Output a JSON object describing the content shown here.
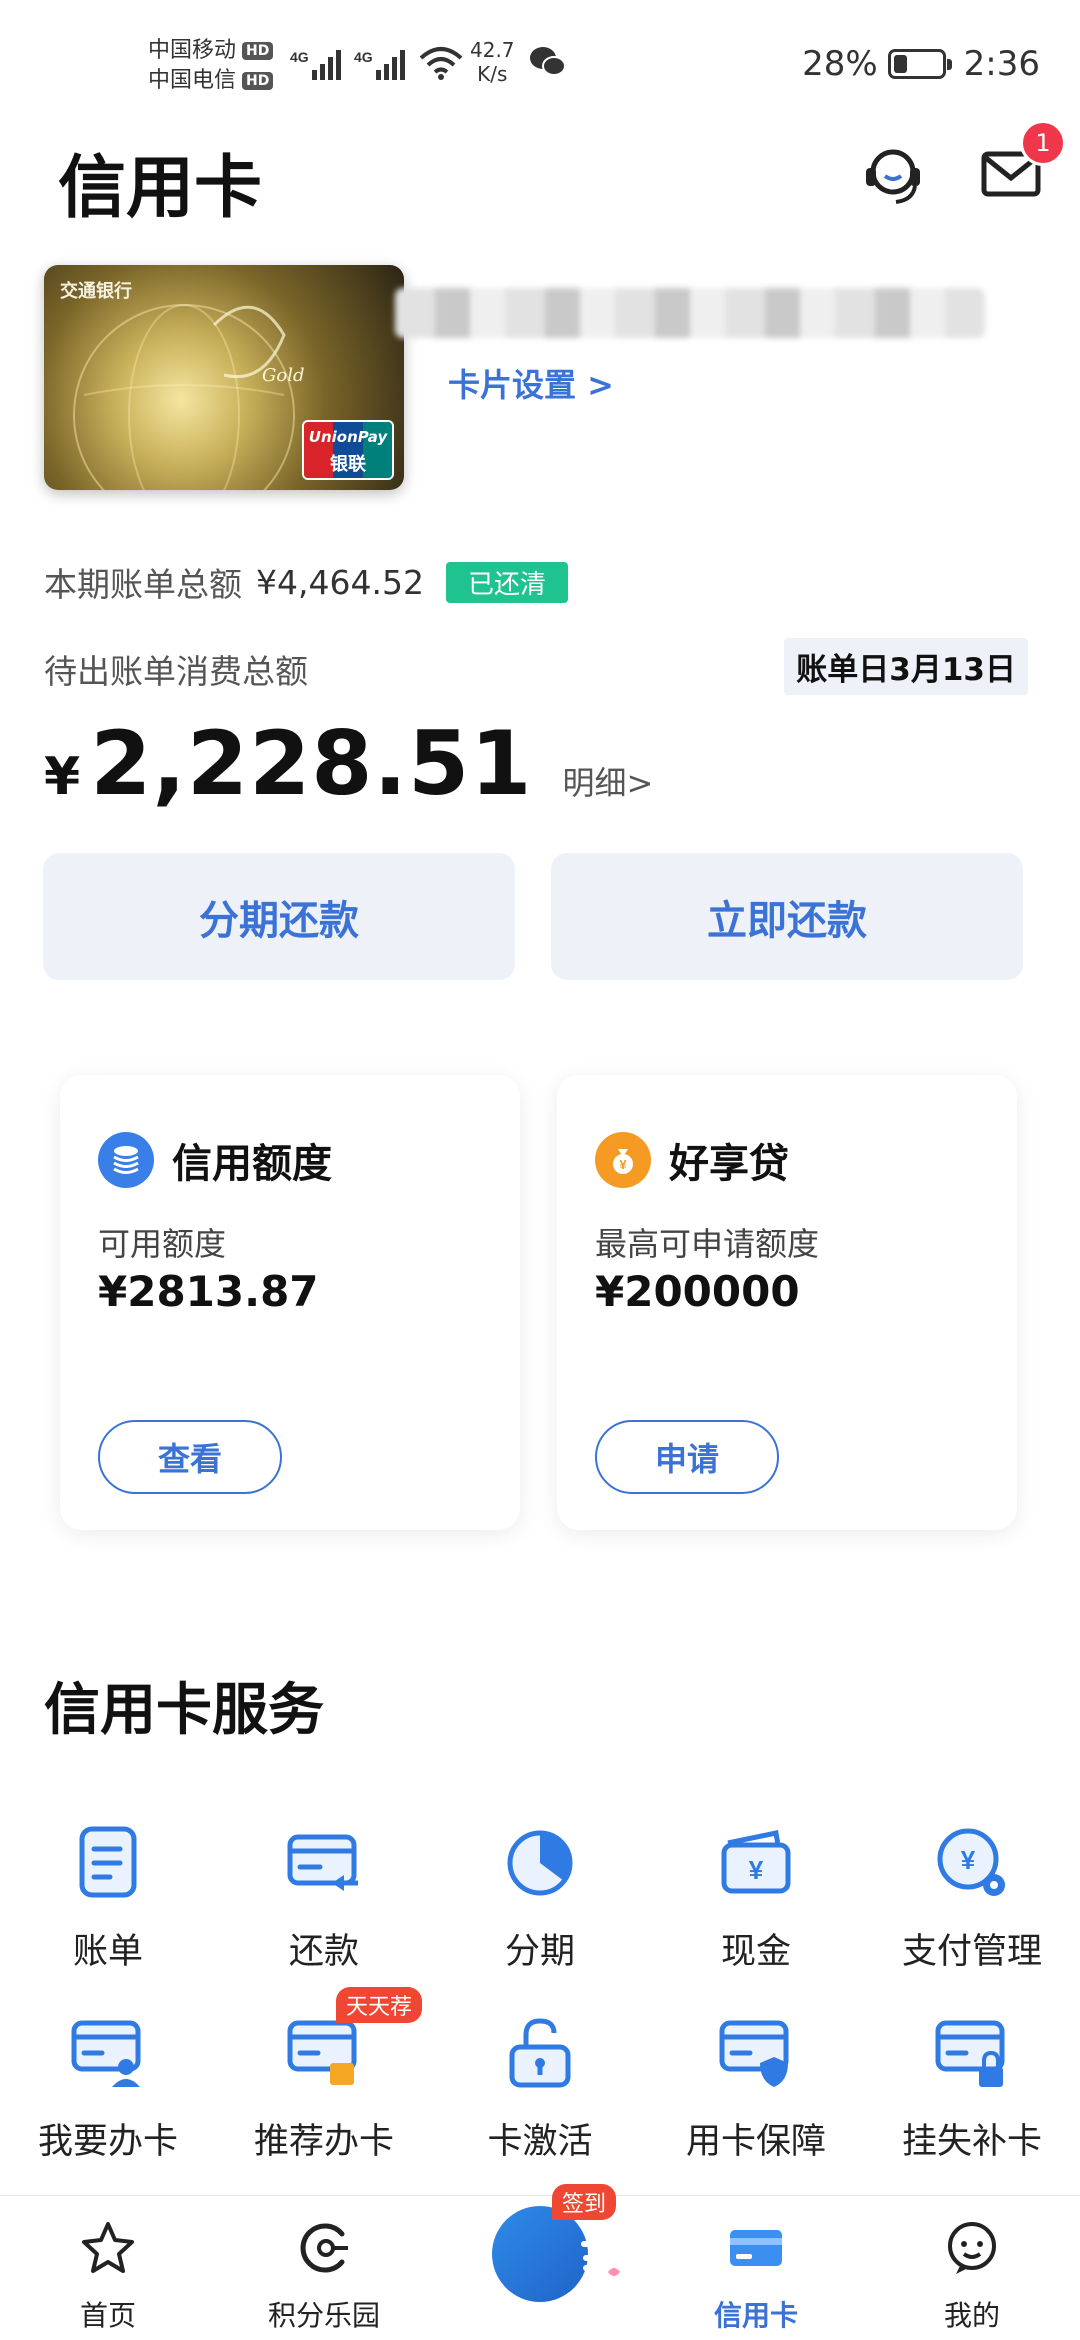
{
  "status_bar": {
    "carrier1": "中国移动",
    "carrier2": "中国电信",
    "hd": "HD",
    "net1": "4G",
    "net2": "4G",
    "speed_value": "42.7",
    "speed_unit": "K/s",
    "battery": "28%",
    "battery_level": 0.28,
    "time": "2:36"
  },
  "header": {
    "title": "信用卡",
    "mail_badge": "1",
    "icons": [
      "customer-service-icon",
      "mail-icon"
    ]
  },
  "card": {
    "bank_name": "交通银行",
    "tier": "Gold",
    "network_en": "UnionPay",
    "network_cn": "银联",
    "settings_label": "卡片设置 >"
  },
  "bill": {
    "total_label": "本期账单总额",
    "total_amount": "¥4,464.52",
    "status_badge": "已还清",
    "pending_label": "待出账单消费总额",
    "bill_day": "账单日3月13日",
    "currency": "¥",
    "pending_amount": "2,228.51",
    "detail_link": "明细>"
  },
  "actions": {
    "installment": "分期还款",
    "repay_now": "立即还款"
  },
  "credit_card": {
    "title": "信用额度",
    "sub": "可用额度",
    "value": "¥2813.87",
    "button": "查看"
  },
  "loan_card": {
    "title": "好享贷",
    "sub": "最高可申请额度",
    "value": "¥200000",
    "button": "申请"
  },
  "services": {
    "title": "信用卡服务",
    "items": [
      {
        "label": "账单",
        "icon": "bill-icon"
      },
      {
        "label": "还款",
        "icon": "repay-icon"
      },
      {
        "label": "分期",
        "icon": "installment-icon"
      },
      {
        "label": "现金",
        "icon": "cash-icon"
      },
      {
        "label": "支付管理",
        "icon": "payment-settings-icon"
      },
      {
        "label": "我要办卡",
        "icon": "apply-card-icon"
      },
      {
        "label": "推荐办卡",
        "icon": "recommend-card-icon",
        "tag": "天天荐"
      },
      {
        "label": "卡激活",
        "icon": "unlock-icon"
      },
      {
        "label": "用卡保障",
        "icon": "card-shield-icon"
      },
      {
        "label": "挂失补卡",
        "icon": "card-lock-icon"
      }
    ]
  },
  "bottom_nav": {
    "items": [
      {
        "label": "首页",
        "icon": "star-icon"
      },
      {
        "label": "积分乐园",
        "icon": "points-icon"
      },
      {
        "label": "",
        "icon": "sign-in-icon",
        "tag": "签到"
      },
      {
        "label": "信用卡",
        "icon": "credit-card-icon",
        "active": true
      },
      {
        "label": "我的",
        "icon": "profile-icon"
      }
    ]
  },
  "colors": {
    "accent": "#3a72d6",
    "paid_green": "#1ec38f",
    "badge_red": "#f0364a",
    "button_bg": "#eef1f7"
  }
}
